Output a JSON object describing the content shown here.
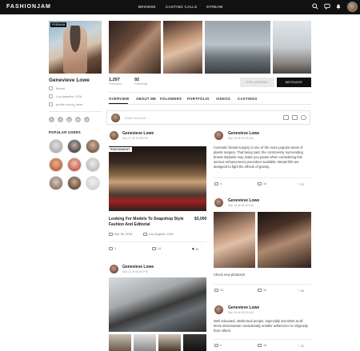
{
  "app": {
    "logo": "FASHIONJAM"
  },
  "nav": {
    "items": [
      "BROWSE",
      "CASTING CALLS",
      "STREAM"
    ]
  },
  "profile": {
    "badge": "PREMIUM",
    "name": "Genevieve Lowe",
    "role": "Model",
    "location": "Los Angeles, USA",
    "handle": "profile.com/g_lowe",
    "socials": [
      "f",
      "t",
      "g",
      "in",
      "p"
    ],
    "popular_title": "POPULAR USERS"
  },
  "stats": {
    "followers_count": "1,297",
    "followers_label": "Followers",
    "following_count": "92",
    "following_label": "Following"
  },
  "buttons": {
    "following": "FOLLOWING",
    "message": "MESSAGE"
  },
  "tabs": [
    "OVERVIEW",
    "ABOUT ME",
    "FOLOWERS",
    "PORTFOLIO",
    "VIDEOS",
    "CASTINGS"
  ],
  "composer": {
    "placeholder": "Write new post"
  },
  "posts": {
    "left1": {
      "author": "Genevieve Lowe",
      "time": "Sep 27 at 12:35 PM",
      "tag": "PHOTOSHOOT",
      "title": "Looking For Models To Snapshop Style Fashion And Editorial",
      "price": "$3,000",
      "date": "Mar 06, 2018",
      "location": "Los Angeles, USA",
      "shares": "3",
      "comments": "24",
      "likes": "45"
    },
    "left2": {
      "author": "Genevieve Lowe",
      "time": "Sep 12 at 06:45 PM"
    },
    "right1": {
      "author": "Genevieve Lowe",
      "time": "Sep 26 at 09:15 AM",
      "text": "Cosmetic breast surgery is one of the more popular areas of plastic surgery. That being said, the controversy surrounding breast implants may make you pause when considering this serious enhancement procedure available. Breast lifts are designed to fight the effects of gravity.",
      "shares": "3",
      "comments": "18",
      "likes": "20"
    },
    "right2": {
      "author": "Genevieve Lowe",
      "time": "Sep 16 at 08:10 AM",
      "text": "Check new photoset!",
      "shares": "23",
      "comments": "32",
      "likes": "58"
    },
    "right3": {
      "author": "Genevieve Lowe",
      "time": "Sep 15 at 09:15 AM",
      "text": "Well educated, intellectual people, especially scientists at all times demonstrate considerably smaller adherence to religiosity than others.",
      "shares": "3",
      "comments": "18",
      "likes": "20"
    }
  },
  "colors": {
    "dark": "#111111",
    "muted": "#999999",
    "border": "#e6e6e6"
  }
}
